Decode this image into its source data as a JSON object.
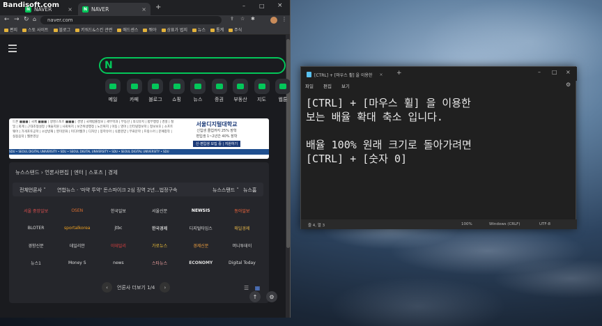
{
  "watermark": "Bandisoft.com",
  "chrome": {
    "tabs": [
      {
        "label": "NAVER",
        "active": false
      },
      {
        "label": "NAVER",
        "active": true
      }
    ],
    "new_tab": "+",
    "url": "naver.com",
    "bookmarks": [
      "편지",
      "스토 사이트",
      "블로그",
      "키워드&스킨 관련",
      "애드센스",
      "뭐야",
      "상표가 법지",
      "뉴스",
      "통계",
      "주식"
    ]
  },
  "naver": {
    "logo": "N",
    "services": [
      "메일",
      "카페",
      "블로그",
      "쇼핑",
      "뉴스",
      "증권",
      "부동산",
      "지도",
      "웹툰"
    ],
    "ad": {
      "left_text": "드론 ■■■ | 국제 ■■■ | 생명스포츠 ■■■ | 경영 | 국제법률정보 | 세무학과 | 부동산 | 의식유지 | 법무행정 | 경찰 | 철밀 | 회계 | 근대조형설정 | 예술지원 | 사회복지 | 보건위생행정 | 노인복지 | 아동 | 영어 | 인터넷정보학 | 정보보호 | 소프트웨어 | 가게포토공학 | 소방방재 | 영미문화 | 미디어웹코 | 디자인 | 봉학유아 | 식품영양 | 무료문학 | 프랑스어 | 문예창작 | 실용음악 | 웹툰영상",
      "stripe": "SDU • SEOUL DIGITAL UNIVERSITY • SDU • SEOUL DIGITAL UNIVERSITY • SDU • SEOUL DIGITAL UNIVERSITY • SDU",
      "title": "서울디지털대학교",
      "line1": "신입생 졸업까지 25% 장학",
      "line2": "편입생 1~2년간 40% 장학",
      "button": "신·편입생 모집 중 | 지원하기"
    },
    "news": {
      "header": "뉴스스탠드 › 언론사편집 | 엔터 | 스포츠 | 경제",
      "all_press": "전체언론사 ˅",
      "headline": "연합뉴스 · '마약 투약' 돈스파이크 2심 징역 2년...법정구속",
      "newsstand": "뉴스스탠드 ˅",
      "newshome": "뉴스홈",
      "press": [
        "서울 중앙일보",
        "OSEN",
        "한국일보",
        "서울신문",
        "NEWSIS",
        "동아일보",
        "BLOTER",
        "sportalkorea",
        "jtbc",
        "한국경제",
        "디지털타임스",
        "매일경제",
        "경향신문",
        "데일리안",
        "이데일리",
        "가로뉴스",
        "경제신문",
        "머니투데이",
        "뉴스1",
        "Money S",
        "news",
        "스타뉴스",
        "ECONOMY",
        "Digital Today"
      ],
      "pager": "언론사 더보기 1/4",
      "prev": "‹",
      "next": "›"
    }
  },
  "notepad": {
    "tab_title": "[CTRL] + [마우스 휠] 을 이용한",
    "menu": [
      "파일",
      "편집",
      "보기"
    ],
    "content": "[CTRL] + [마우스 휠] 을 이용한\n보는 배율 확대 축소 입니다.\n\n배율 100% 원래 크기로 돌아가려면\n[CTRL] + [숫자 0]",
    "status": {
      "position": "줄 4, 열 3",
      "zoom": "100%",
      "line_ending": "Windows (CRLF)",
      "encoding": "UTF-8"
    }
  }
}
